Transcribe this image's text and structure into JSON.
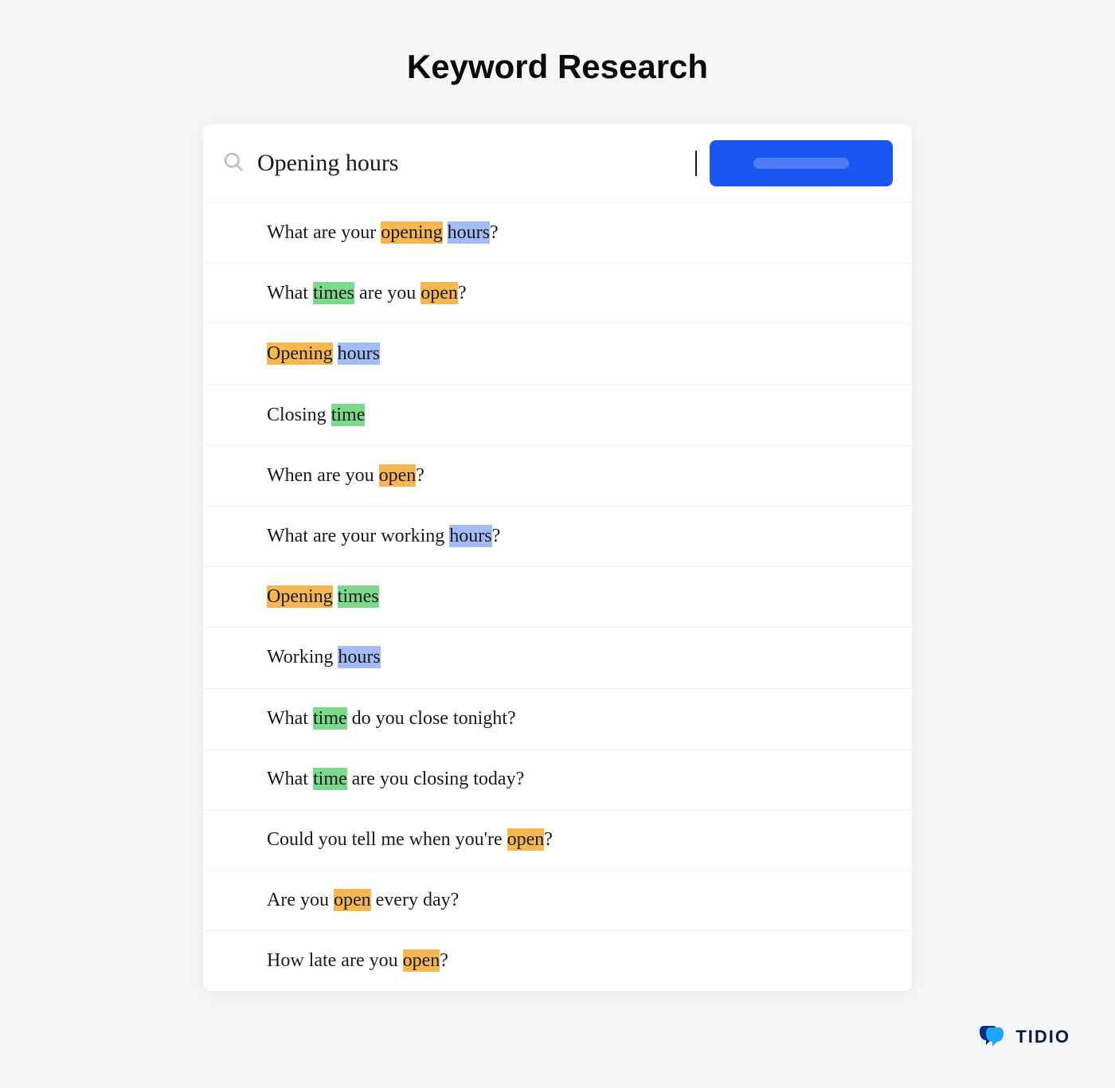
{
  "title": "Keyword Research",
  "search": {
    "query": "Opening hours"
  },
  "highlight_colors": {
    "orange": "#f5b750",
    "blue": "#a3bcf5",
    "green": "#7ad98a"
  },
  "results": [
    {
      "segments": [
        {
          "t": "What are your ",
          "hl": null
        },
        {
          "t": "opening",
          "hl": "orange"
        },
        {
          "t": " ",
          "hl": null
        },
        {
          "t": "hours",
          "hl": "blue"
        },
        {
          "t": "?",
          "hl": null
        }
      ]
    },
    {
      "segments": [
        {
          "t": "What ",
          "hl": null
        },
        {
          "t": "times",
          "hl": "green"
        },
        {
          "t": " are you ",
          "hl": null
        },
        {
          "t": "open",
          "hl": "orange"
        },
        {
          "t": "?",
          "hl": null
        }
      ]
    },
    {
      "segments": [
        {
          "t": "Opening",
          "hl": "orange"
        },
        {
          "t": " ",
          "hl": null
        },
        {
          "t": "hours",
          "hl": "blue"
        }
      ]
    },
    {
      "segments": [
        {
          "t": "Closing ",
          "hl": null
        },
        {
          "t": "time",
          "hl": "green"
        }
      ]
    },
    {
      "segments": [
        {
          "t": "When are you ",
          "hl": null
        },
        {
          "t": "open",
          "hl": "orange"
        },
        {
          "t": "?",
          "hl": null
        }
      ]
    },
    {
      "segments": [
        {
          "t": "What are your working ",
          "hl": null
        },
        {
          "t": "hours",
          "hl": "blue"
        },
        {
          "t": "?",
          "hl": null
        }
      ]
    },
    {
      "segments": [
        {
          "t": "Opening",
          "hl": "orange"
        },
        {
          "t": " ",
          "hl": null
        },
        {
          "t": "times",
          "hl": "green"
        }
      ]
    },
    {
      "segments": [
        {
          "t": "Working ",
          "hl": null
        },
        {
          "t": "hours",
          "hl": "blue"
        }
      ]
    },
    {
      "segments": [
        {
          "t": "What ",
          "hl": null
        },
        {
          "t": "time",
          "hl": "green"
        },
        {
          "t": " do you close tonight?",
          "hl": null
        }
      ]
    },
    {
      "segments": [
        {
          "t": "What ",
          "hl": null
        },
        {
          "t": "time",
          "hl": "green"
        },
        {
          "t": " are you closing today?",
          "hl": null
        }
      ]
    },
    {
      "segments": [
        {
          "t": "Could you tell me when you're ",
          "hl": null
        },
        {
          "t": "open",
          "hl": "orange"
        },
        {
          "t": "?",
          "hl": null
        }
      ]
    },
    {
      "segments": [
        {
          "t": "Are you ",
          "hl": null
        },
        {
          "t": "open",
          "hl": "orange"
        },
        {
          "t": " every day?",
          "hl": null
        }
      ]
    },
    {
      "segments": [
        {
          "t": "How late are you ",
          "hl": null
        },
        {
          "t": "open",
          "hl": "orange"
        },
        {
          "t": "?",
          "hl": null
        }
      ]
    }
  ],
  "brand": {
    "name": "TIDIO"
  }
}
